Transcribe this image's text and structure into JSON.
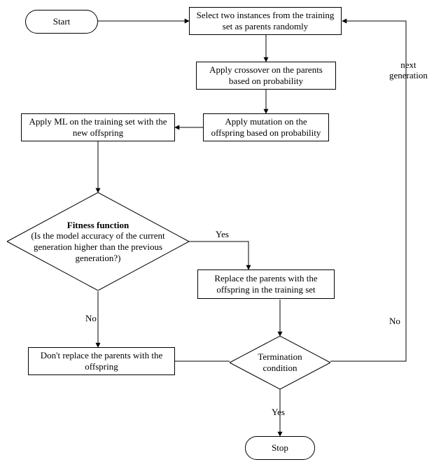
{
  "nodes": {
    "start": "Start",
    "select": "Select two instances from the training set as parents randomly",
    "crossover": "Apply crossover on the parents based on probability",
    "mutation": "Apply mutation on the offspring based on probability",
    "applyML": "Apply ML on the training set with the new offspring",
    "fitness_title": "Fitness function",
    "fitness_body": "(Is the model accuracy of the current generation higher than the previous generation?)",
    "replace": "Replace the parents with the offspring in the training set",
    "dontreplace": "Don't replace the parents with the offspring",
    "terminate": "Termination condition",
    "stop": "Stop"
  },
  "edges": {
    "yes1": "Yes",
    "no1": "No",
    "yes2": "Yes",
    "no2": "No",
    "nextgen": "next\ngeneration"
  }
}
